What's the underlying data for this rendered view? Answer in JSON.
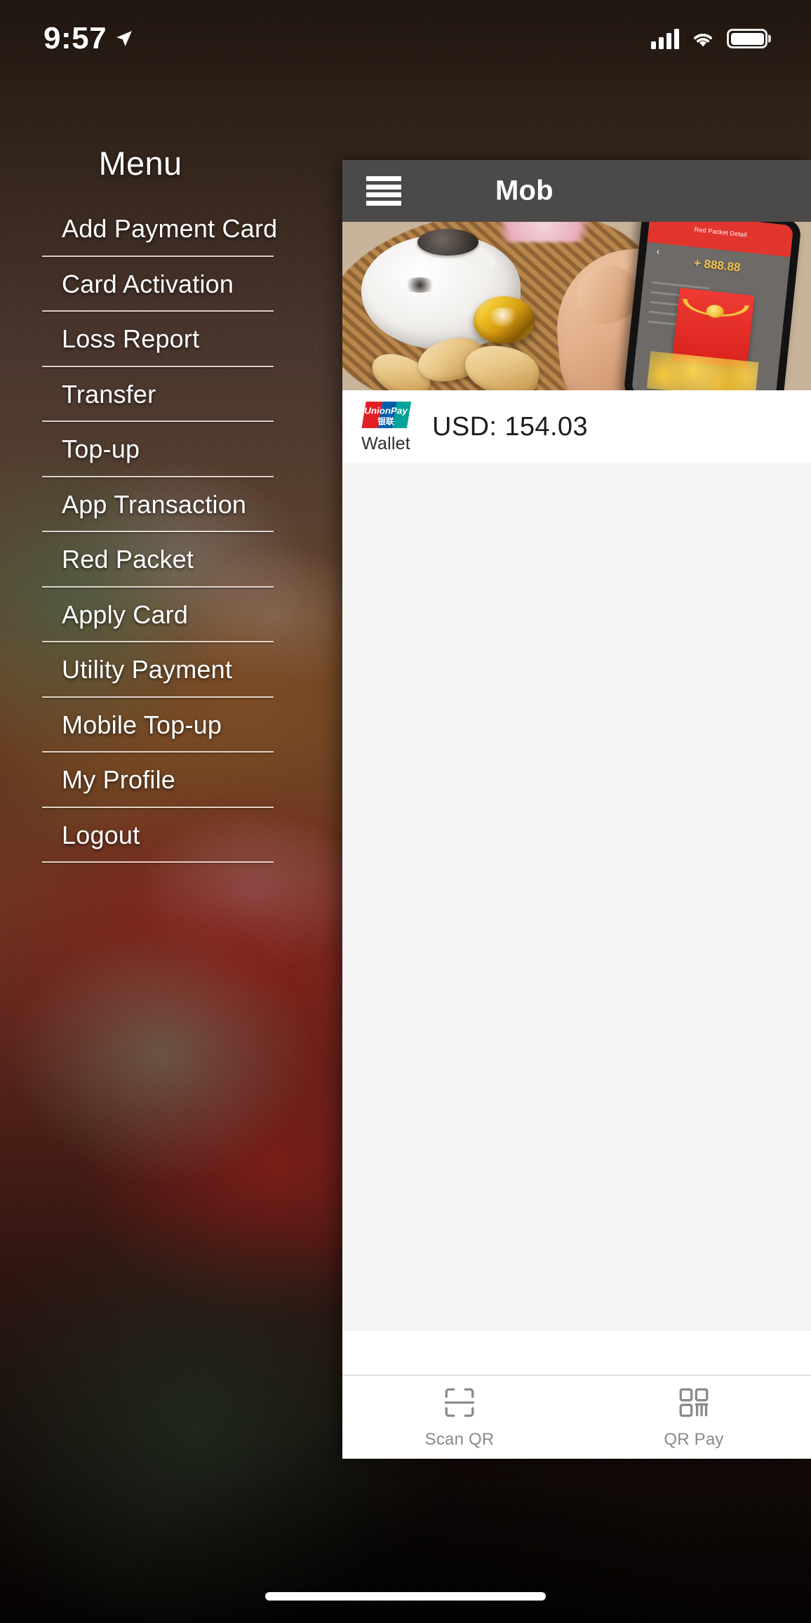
{
  "status_bar": {
    "time": "9:57",
    "location_icon": "location-arrow-icon",
    "signal_icon": "cellular-signal-icon",
    "wifi_icon": "wifi-icon",
    "battery_icon": "battery-full-icon"
  },
  "drawer": {
    "title": "Menu",
    "items": [
      {
        "label": "Add Payment Card"
      },
      {
        "label": "Card Activation"
      },
      {
        "label": "Loss Report"
      },
      {
        "label": "Transfer"
      },
      {
        "label": "Top-up"
      },
      {
        "label": "App Transaction"
      },
      {
        "label": "Red Packet"
      },
      {
        "label": "Apply Card"
      },
      {
        "label": "Utility Payment"
      },
      {
        "label": "Mobile Top-up"
      },
      {
        "label": "My Profile"
      },
      {
        "label": "Logout"
      }
    ]
  },
  "app": {
    "header": {
      "menu_icon": "hamburger-menu-icon",
      "title": "Mob"
    },
    "banner": {
      "phone_screen_title": "Red Packet Detail",
      "phone_screen_amount": "+ 888.88",
      "back_chevron": "‹"
    },
    "wallet": {
      "brand_logo": "unionpay-logo",
      "brand_label": "Wallet",
      "balance": "USD: 154.03"
    },
    "bottom_nav": [
      {
        "label": "Scan QR",
        "icon": "scan-qr-icon"
      },
      {
        "label": "QR Pay",
        "icon": "qr-code-icon"
      }
    ]
  },
  "colors": {
    "header_bg": "#4c4a48",
    "panel_bg": "#f4f4f4",
    "unionpay_red": "#e21f26",
    "unionpay_blue": "#005bac",
    "unionpay_green": "#00a29a",
    "nav_label": "#8a8a8a"
  }
}
